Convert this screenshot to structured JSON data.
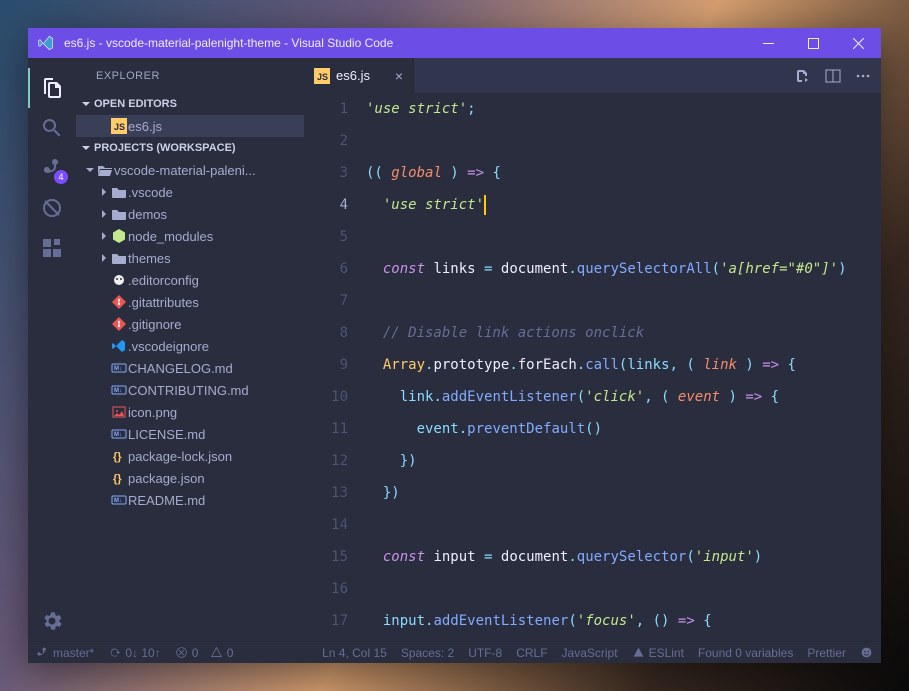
{
  "window": {
    "title": "es6.js - vscode-material-palenight-theme - Visual Studio Code"
  },
  "activityBar": {
    "scmBadge": "4"
  },
  "sidebar": {
    "title": "EXPLORER",
    "openEditors": {
      "label": "OPEN EDITORS",
      "items": [
        {
          "name": "es6.js",
          "icon": "js"
        }
      ]
    },
    "workspace": {
      "label": "PROJECTS (WORKSPACE)",
      "root": {
        "name": "vscode-material-paleni...",
        "children": [
          {
            "name": ".vscode",
            "kind": "folder"
          },
          {
            "name": "demos",
            "kind": "folder"
          },
          {
            "name": "node_modules",
            "kind": "node"
          },
          {
            "name": "themes",
            "kind": "folder"
          },
          {
            "name": ".editorconfig",
            "kind": "editorcfg"
          },
          {
            "name": ".gitattributes",
            "kind": "git"
          },
          {
            "name": ".gitignore",
            "kind": "git"
          },
          {
            "name": ".vscodeignore",
            "kind": "vscode"
          },
          {
            "name": "CHANGELOG.md",
            "kind": "md"
          },
          {
            "name": "CONTRIBUTING.md",
            "kind": "md"
          },
          {
            "name": "icon.png",
            "kind": "img"
          },
          {
            "name": "LICENSE.md",
            "kind": "md"
          },
          {
            "name": "package-lock.json",
            "kind": "json"
          },
          {
            "name": "package.json",
            "kind": "json"
          },
          {
            "name": "README.md",
            "kind": "md"
          }
        ]
      }
    }
  },
  "editor": {
    "tab": {
      "name": "es6.js",
      "icon": "js"
    },
    "currentLine": 4,
    "lines": [
      [
        {
          "t": "str",
          "v": "'use strict'"
        },
        {
          "t": "pn",
          "v": ";"
        }
      ],
      [],
      [
        {
          "t": "pn",
          "v": "(( "
        },
        {
          "t": "prm",
          "v": "global"
        },
        {
          "t": "pn",
          "v": " ) "
        },
        {
          "t": "kw",
          "v": "=>"
        },
        {
          "t": "pn",
          "v": " {"
        }
      ],
      [
        {
          "t": "pn",
          "v": "  "
        },
        {
          "t": "str",
          "v": "'use strict'"
        },
        {
          "t": "cursor",
          "v": ""
        }
      ],
      [],
      [
        {
          "t": "pn",
          "v": "  "
        },
        {
          "t": "kw",
          "v": "const"
        },
        {
          "t": "var",
          "v": " links "
        },
        {
          "t": "op",
          "v": "="
        },
        {
          "t": "var",
          "v": " document"
        },
        {
          "t": "op",
          "v": "."
        },
        {
          "t": "fn",
          "v": "querySelectorAll"
        },
        {
          "t": "pn",
          "v": "("
        },
        {
          "t": "str",
          "v": "'a[href=\"#0\"]'"
        },
        {
          "t": "pn",
          "v": ")"
        }
      ],
      [],
      [
        {
          "t": "pn",
          "v": "  "
        },
        {
          "t": "cmt",
          "v": "// Disable link actions onclick"
        }
      ],
      [
        {
          "t": "pn",
          "v": "  "
        },
        {
          "t": "obj",
          "v": "Array"
        },
        {
          "t": "op",
          "v": "."
        },
        {
          "t": "var",
          "v": "prototype"
        },
        {
          "t": "op",
          "v": "."
        },
        {
          "t": "var",
          "v": "forEach"
        },
        {
          "t": "op",
          "v": "."
        },
        {
          "t": "fn",
          "v": "call"
        },
        {
          "t": "pn",
          "v": "(links, ( "
        },
        {
          "t": "prm",
          "v": "link"
        },
        {
          "t": "pn",
          "v": " ) "
        },
        {
          "t": "kw",
          "v": "=>"
        },
        {
          "t": "pn",
          "v": " {"
        }
      ],
      [
        {
          "t": "pn",
          "v": "    link"
        },
        {
          "t": "op",
          "v": "."
        },
        {
          "t": "fn",
          "v": "addEventListener"
        },
        {
          "t": "pn",
          "v": "("
        },
        {
          "t": "str",
          "v": "'click'"
        },
        {
          "t": "pn",
          "v": ", ( "
        },
        {
          "t": "prm",
          "v": "event"
        },
        {
          "t": "pn",
          "v": " ) "
        },
        {
          "t": "kw",
          "v": "=>"
        },
        {
          "t": "pn",
          "v": " {"
        }
      ],
      [
        {
          "t": "pn",
          "v": "      event"
        },
        {
          "t": "op",
          "v": "."
        },
        {
          "t": "fn",
          "v": "preventDefault"
        },
        {
          "t": "pn",
          "v": "()"
        }
      ],
      [
        {
          "t": "pn",
          "v": "    })"
        }
      ],
      [
        {
          "t": "pn",
          "v": "  })"
        }
      ],
      [],
      [
        {
          "t": "pn",
          "v": "  "
        },
        {
          "t": "kw",
          "v": "const"
        },
        {
          "t": "var",
          "v": " input "
        },
        {
          "t": "op",
          "v": "="
        },
        {
          "t": "var",
          "v": " document"
        },
        {
          "t": "op",
          "v": "."
        },
        {
          "t": "fn",
          "v": "querySelector"
        },
        {
          "t": "pn",
          "v": "("
        },
        {
          "t": "str",
          "v": "'input'"
        },
        {
          "t": "pn",
          "v": ")"
        }
      ],
      [],
      [
        {
          "t": "pn",
          "v": "  input"
        },
        {
          "t": "op",
          "v": "."
        },
        {
          "t": "fn",
          "v": "addEventListener"
        },
        {
          "t": "pn",
          "v": "("
        },
        {
          "t": "str",
          "v": "'focus'"
        },
        {
          "t": "pn",
          "v": ", () "
        },
        {
          "t": "kw",
          "v": "=>"
        },
        {
          "t": "pn",
          "v": " {"
        }
      ]
    ]
  },
  "statusBar": {
    "branch": "master*",
    "sync": "0↓ 10↑",
    "errors": "0",
    "warnings": "0",
    "cursor": "Ln 4, Col 15",
    "spaces": "Spaces: 2",
    "encoding": "UTF-8",
    "eol": "CRLF",
    "lang": "JavaScript",
    "eslint": "ESLint",
    "vars": "Found 0 variables",
    "prettier": "Prettier"
  }
}
